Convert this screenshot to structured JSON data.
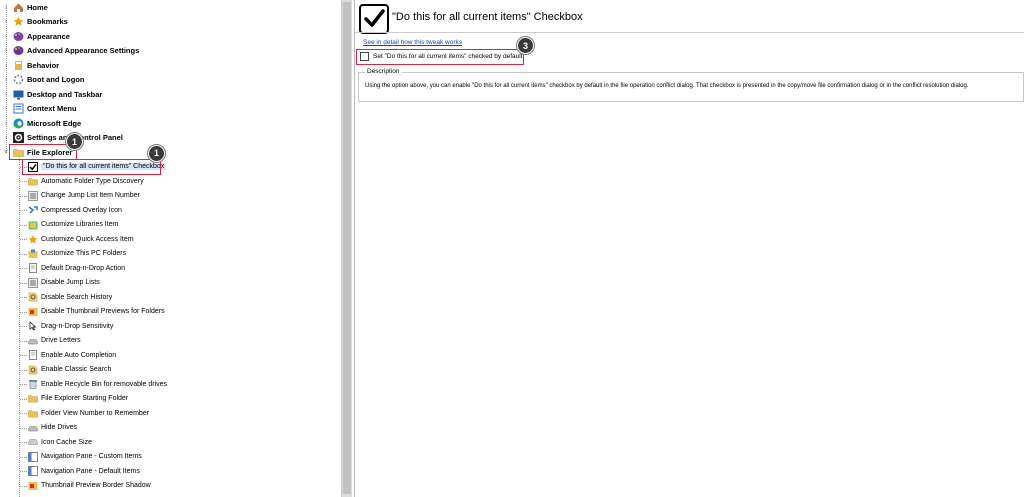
{
  "tree": {
    "top_items": [
      {
        "label": "Home",
        "icon": "home-icon",
        "color": "#c4733a"
      },
      {
        "label": "Bookmarks",
        "icon": "star-icon",
        "color": "#e8a317"
      },
      {
        "label": "Appearance",
        "icon": "palette-icon",
        "color": "#7a3fb5"
      },
      {
        "label": "Advanced Appearance Settings",
        "icon": "palette-icon",
        "color": "#6a2fa0"
      },
      {
        "label": "Behavior",
        "icon": "behavior-icon",
        "color": "#d8b84a"
      },
      {
        "label": "Boot and Logon",
        "icon": "boot-icon",
        "color": "#4a7fc1"
      },
      {
        "label": "Desktop and Taskbar",
        "icon": "desktop-icon",
        "color": "#1f5fa8"
      },
      {
        "label": "Context Menu",
        "icon": "context-menu-icon",
        "color": "#3a7ac8"
      },
      {
        "label": "Microsoft Edge",
        "icon": "edge-icon",
        "color": "#0f8fc6"
      },
      {
        "label": "Settings and Control Panel",
        "icon": "gear-icon",
        "color": "#333333"
      },
      {
        "label": "File Explorer",
        "icon": "folder-icon",
        "color": "#e9c35a"
      }
    ],
    "children": [
      {
        "label": "\"Do this for all current items\" Checkbox",
        "icon": "checkbox-icon"
      },
      {
        "label": "Automatic Folder Type Discovery",
        "icon": "folder-icon"
      },
      {
        "label": "Change Jump List Item Number",
        "icon": "list-icon"
      },
      {
        "label": "Compressed Overlay Icon",
        "icon": "overlay-icon"
      },
      {
        "label": "Customize Libraries Item",
        "icon": "library-icon"
      },
      {
        "label": "Customize Quick Access Item",
        "icon": "star-icon"
      },
      {
        "label": "Customize This PC Folders",
        "icon": "pc-folder-icon"
      },
      {
        "label": "Default Drag-n-Drop Action",
        "icon": "document-icon"
      },
      {
        "label": "Disable Jump Lists",
        "icon": "list-icon"
      },
      {
        "label": "Disable Search History",
        "icon": "search-history-icon"
      },
      {
        "label": "Disable Thumbnail Previews for Folders",
        "icon": "thumbnail-icon"
      },
      {
        "label": "Drag-n-Drop Sensitivity",
        "icon": "drag-icon"
      },
      {
        "label": "Drive Letters",
        "icon": "drive-icon"
      },
      {
        "label": "Enable Auto Completion",
        "icon": "document-icon"
      },
      {
        "label": "Enable Classic Search",
        "icon": "search-history-icon"
      },
      {
        "label": "Enable Recycle Bin for removable drives",
        "icon": "recycle-bin-icon"
      },
      {
        "label": "File Explorer Starting Folder",
        "icon": "folder-icon"
      },
      {
        "label": "Folder View Number to Remember",
        "icon": "folder-icon"
      },
      {
        "label": "Hide Drives",
        "icon": "drive-icon"
      },
      {
        "label": "Icon Cache Size",
        "icon": "cache-icon"
      },
      {
        "label": "Navigation Pane - Custom Items",
        "icon": "nav-pane-icon"
      },
      {
        "label": "Navigation Pane - Default Items",
        "icon": "nav-pane-icon"
      },
      {
        "label": "Thumbnail Preview Border Shadow",
        "icon": "thumbnail-icon"
      }
    ]
  },
  "badges": {
    "one_a": "1",
    "one_b": "1",
    "three": "3"
  },
  "detail": {
    "title": "\"Do this for all current items\" Checkbox",
    "link": "See in detail how this tweak works",
    "option_label": "Set \"Do this for all current items\" checked by default",
    "desc_title": "Description",
    "desc_text": "Using the option above, you can enable \"Do this for all current items\" checkbox by default in the file operation conflict dialog. That checkbox is presented in the copy/move file confirmation dialog or in the conflict resolution dialog."
  },
  "colors": {
    "highlight": "#d9243c",
    "badge": "#3a3a3a",
    "link": "#1a3ec7"
  }
}
